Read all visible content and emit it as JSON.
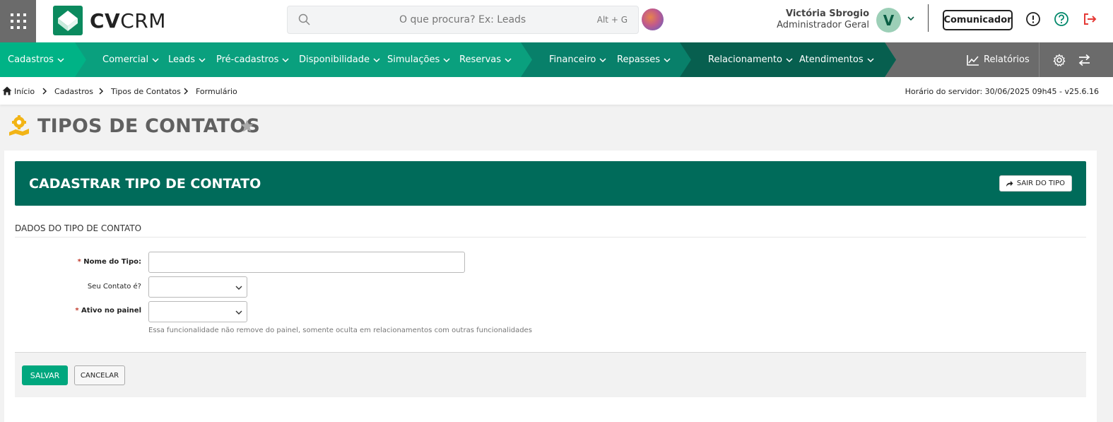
{
  "colors": {
    "brand_green": "#00a77e",
    "dark_green": "#006b5a",
    "nav_gray": "#6b6b6b",
    "danger": "#e53935"
  },
  "header": {
    "logo_bold": "CV",
    "logo_light": "CRM",
    "search_placeholder": "O que procura? Ex: Leads",
    "search_shortcut": "Alt + G",
    "user_name": "Victória Sbrogio",
    "user_role": "Administrador Geral",
    "avatar_initial": "V",
    "communicator_label": "Comunicador",
    "icons": [
      "apps-grid-icon",
      "search-icon",
      "globe-icon",
      "chevron-down-icon",
      "info-icon",
      "help-icon",
      "logout-icon"
    ]
  },
  "nav": {
    "items": [
      {
        "label": "Cadastros"
      },
      {
        "label": "Comercial"
      },
      {
        "label": "Leads"
      },
      {
        "label": "Pré-cadastros"
      },
      {
        "label": "Disponibilidade"
      },
      {
        "label": "Simulações"
      },
      {
        "label": "Reservas"
      },
      {
        "label": "Financeiro"
      },
      {
        "label": "Repasses"
      },
      {
        "label": "Relacionamento"
      },
      {
        "label": "Atendimentos"
      }
    ],
    "reports_label": "Relatórios"
  },
  "breadcrumb": {
    "items": [
      "Início",
      "Cadastros",
      "Tipos de Contatos",
      "Formulário"
    ],
    "server_time": "Horário do servidor: 30/06/2025 09h45 - v25.6.16"
  },
  "page": {
    "title": "TIPOS DE CONTATOS"
  },
  "form": {
    "panel_title": "CADASTRAR TIPO DE CONTATO",
    "exit_label": "SAIR DO TIPO",
    "section_title": "DADOS DO TIPO DE CONTATO",
    "fields": {
      "nome": {
        "label": "Nome do Tipo:",
        "required": true,
        "value": ""
      },
      "seu_contato": {
        "label": "Seu Contato é?",
        "required": false,
        "value": ""
      },
      "ativo": {
        "label": "Ativo no painel",
        "required": true,
        "value": ""
      }
    },
    "required_mark": "*",
    "help_text": "Essa funcionalidade não remove do painel, somente oculta em relacionamentos com outras funcionalidades",
    "save_label": "SALVAR",
    "cancel_label": "CANCELAR"
  }
}
